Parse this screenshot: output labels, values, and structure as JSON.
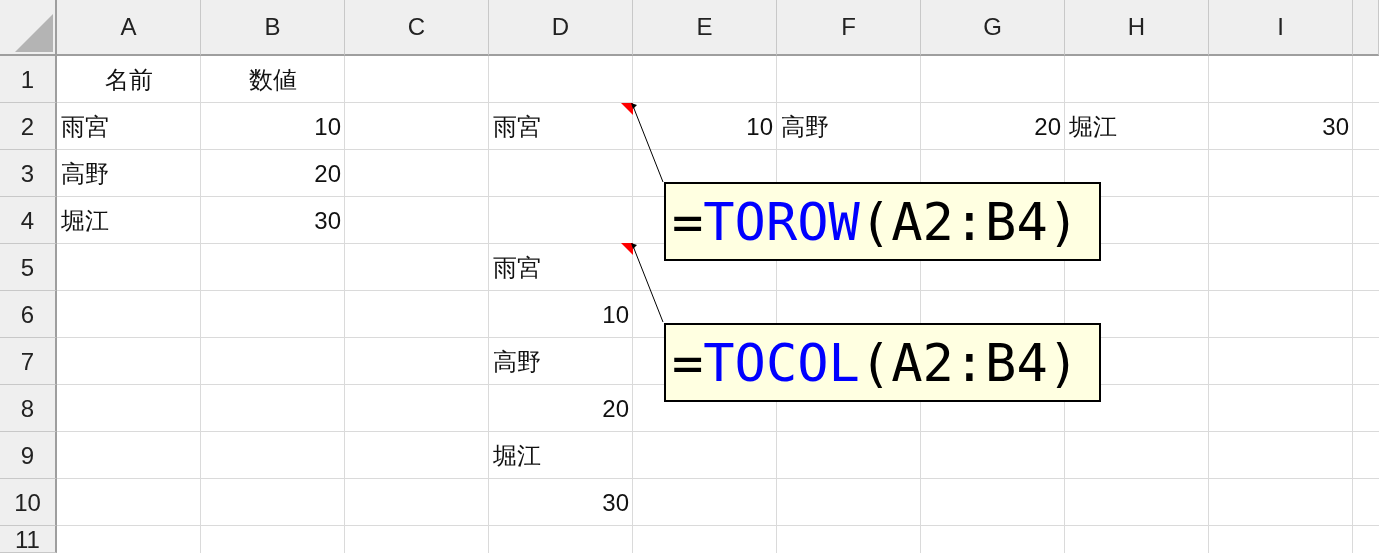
{
  "columns": [
    "A",
    "B",
    "C",
    "D",
    "E",
    "F",
    "G",
    "H",
    "I"
  ],
  "rows": [
    {
      "header": "1",
      "cells": [
        {
          "text": "名前",
          "kind": "heading"
        },
        {
          "text": "数値",
          "kind": "heading"
        },
        null,
        null,
        null,
        null,
        null,
        null,
        null
      ]
    },
    {
      "header": "2",
      "cells": [
        {
          "text": "雨宮",
          "kind": "text"
        },
        {
          "text": "10",
          "kind": "number"
        },
        null,
        {
          "text": "雨宮",
          "kind": "text"
        },
        {
          "text": "10",
          "kind": "number"
        },
        {
          "text": "高野",
          "kind": "text"
        },
        {
          "text": "20",
          "kind": "number"
        },
        {
          "text": "堀江",
          "kind": "text"
        },
        {
          "text": "30",
          "kind": "number"
        }
      ]
    },
    {
      "header": "3",
      "cells": [
        {
          "text": "高野",
          "kind": "text"
        },
        {
          "text": "20",
          "kind": "number"
        },
        null,
        null,
        null,
        null,
        null,
        null,
        null
      ]
    },
    {
      "header": "4",
      "cells": [
        {
          "text": "堀江",
          "kind": "text"
        },
        {
          "text": "30",
          "kind": "number"
        },
        null,
        null,
        null,
        null,
        null,
        null,
        null
      ]
    },
    {
      "header": "5",
      "cells": [
        null,
        null,
        null,
        {
          "text": "雨宮",
          "kind": "text"
        },
        null,
        null,
        null,
        null,
        null
      ]
    },
    {
      "header": "6",
      "cells": [
        null,
        null,
        null,
        {
          "text": "10",
          "kind": "number"
        },
        null,
        null,
        null,
        null,
        null
      ]
    },
    {
      "header": "7",
      "cells": [
        null,
        null,
        null,
        {
          "text": "高野",
          "kind": "text"
        },
        null,
        null,
        null,
        null,
        null
      ]
    },
    {
      "header": "8",
      "cells": [
        null,
        null,
        null,
        {
          "text": "20",
          "kind": "number"
        },
        null,
        null,
        null,
        null,
        null
      ]
    },
    {
      "header": "9",
      "cells": [
        null,
        null,
        null,
        {
          "text": "堀江",
          "kind": "text"
        },
        null,
        null,
        null,
        null,
        null
      ]
    },
    {
      "header": "10",
      "cells": [
        null,
        null,
        null,
        {
          "text": "30",
          "kind": "number"
        },
        null,
        null,
        null,
        null,
        null
      ]
    },
    {
      "header": "11"
    }
  ],
  "comments": [
    {
      "equals": "=",
      "function": "TOROW",
      "args": "(A2:B4)"
    },
    {
      "equals": "=",
      "function": "TOCOL",
      "args": "(A2:B4)"
    }
  ]
}
